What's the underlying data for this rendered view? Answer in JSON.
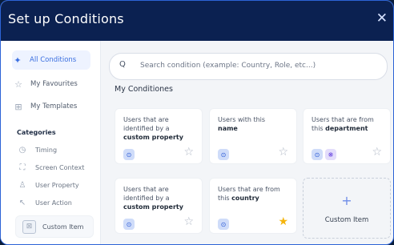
{
  "modal": {
    "title": "Set up Conditions",
    "close_icon": "close-icon"
  },
  "sidebar": {
    "items": [
      {
        "label": "All Conditions",
        "icon": "sparkle-icon",
        "active": true
      },
      {
        "label": "My Favourites",
        "icon": "star-outline-icon",
        "active": false
      },
      {
        "label": "My Templates",
        "icon": "grid-icon",
        "active": false
      }
    ],
    "categories_title": "Categories",
    "categories": [
      {
        "label": "Timing",
        "icon": "clock-icon"
      },
      {
        "label": "Screen Context",
        "icon": "screen-context-icon"
      },
      {
        "label": "User Property",
        "icon": "user-icon"
      },
      {
        "label": "User Action",
        "icon": "cursor-icon"
      }
    ],
    "custom_item_label": "Custom Item"
  },
  "search": {
    "placeholder": "Search condition (example: Country, Role, etc...)"
  },
  "section_title": "My Conditiones",
  "cards": [
    {
      "line1": "Users that are",
      "line2": "identified by a",
      "bold": "custom property",
      "favourite": false
    },
    {
      "line1": "Users with this",
      "line2": "",
      "bold": "name",
      "favourite": false
    },
    {
      "line1": "Users that are from",
      "line2": "this",
      "bold": "department",
      "favourite": false
    },
    {
      "line1": "Users that are",
      "line2": "identified by a",
      "bold": "custom property",
      "favourite": false
    },
    {
      "line1": "Users that are from",
      "line2": "this",
      "bold": "country",
      "favourite": true
    }
  ],
  "custom_card_label": "Custom Item",
  "colors": {
    "header": "#0b2151",
    "accent": "#3b6fe0",
    "star_active": "#f5b50d"
  }
}
